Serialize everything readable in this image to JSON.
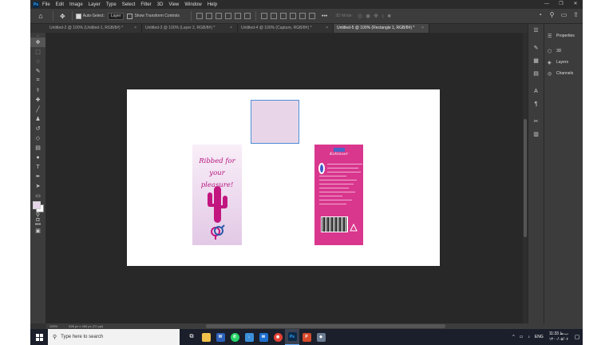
{
  "app": {
    "logo": "Ps",
    "menu": [
      "File",
      "Edit",
      "Image",
      "Layer",
      "Type",
      "Select",
      "Filter",
      "3D",
      "View",
      "Window",
      "Help"
    ],
    "window_controls": [
      "—",
      "❐",
      "✕"
    ]
  },
  "options_bar": {
    "auto_select_label": "Auto-Select:",
    "layer_select_value": "Layer",
    "show_transform_label": "Show Transform Controls",
    "mode_3d_label": "3D Mode:"
  },
  "tabs": [
    {
      "label": "Untitled-2 @ 100% (Untitled-1, RGB/8#) *",
      "close": "×"
    },
    {
      "label": "Untitled-3 @ 100% (Layer 2, RGB/8#) *",
      "close": "×"
    },
    {
      "label": "Untitled-4 @ 100% (Capture, RGB/8#) *",
      "close": "×"
    },
    {
      "label": "Untitled-5 @ 100% (Rectangle 1, RGB/8#) *",
      "close": "×"
    }
  ],
  "canvas": {
    "pack_front_text": "Ribbed for your pleasure!",
    "pack_back_brand": "Kohinoor",
    "colors": {
      "pack_pink": "#d9378e",
      "selection_fill": "#e8d6e8",
      "headline": "#b4147e"
    }
  },
  "right_panel": {
    "items": [
      "Properties",
      "3D",
      "Layers",
      "Channels"
    ]
  },
  "status_bar": {
    "zoom": "100%",
    "doc_info": "828 px x 460 px (72 ppi)"
  },
  "taskbar": {
    "search_placeholder": "Type here to search",
    "language": "ENG",
    "time": "11:33 ب.ظ",
    "date": "۱۴۰۰/۰۵/۰۶"
  }
}
